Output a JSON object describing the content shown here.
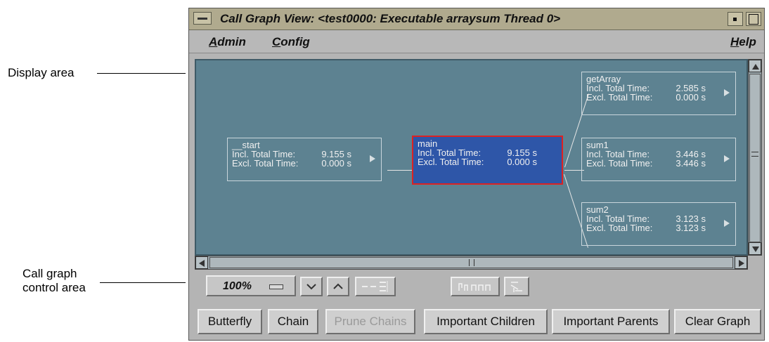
{
  "callouts": {
    "display_area": "Display area",
    "control_area_line1": "Call graph",
    "control_area_line2": "control area"
  },
  "window": {
    "title": "Call Graph View: <test0000: Executable arraysum Thread 0>"
  },
  "menubar": {
    "admin_first": "A",
    "admin_rest": "dmin",
    "config_first": "C",
    "config_rest": "onfig",
    "help_first": "H",
    "help_rest": "elp"
  },
  "graph": {
    "incl_label": "Incl. Total Time:",
    "excl_label": "Excl. Total Time:",
    "nodes": [
      {
        "name": "__start",
        "incl": "9.155 s",
        "excl": "0.000 s",
        "selected": false
      },
      {
        "name": "main",
        "incl": "9.155 s",
        "excl": "0.000 s",
        "selected": true
      },
      {
        "name": "getArray",
        "incl": "2.585 s",
        "excl": "0.000 s",
        "selected": false
      },
      {
        "name": "sum1",
        "incl": "3.446 s",
        "excl": "3.446 s",
        "selected": false
      },
      {
        "name": "sum2",
        "incl": "3.123 s",
        "excl": "3.123 s",
        "selected": false
      }
    ],
    "colors": {
      "background": "#5d8291",
      "selected_fill": "#2e56a8",
      "selected_border": "#dd2222"
    }
  },
  "controls": {
    "zoom_value": "100%",
    "buttons": [
      {
        "label": "Butterfly",
        "enabled": true
      },
      {
        "label": "Chain",
        "enabled": true
      },
      {
        "label": "Prune Chains",
        "enabled": false
      },
      {
        "label": "Important Children",
        "enabled": true
      },
      {
        "label": "Important Parents",
        "enabled": true
      },
      {
        "label": "Clear Graph",
        "enabled": true
      }
    ]
  }
}
